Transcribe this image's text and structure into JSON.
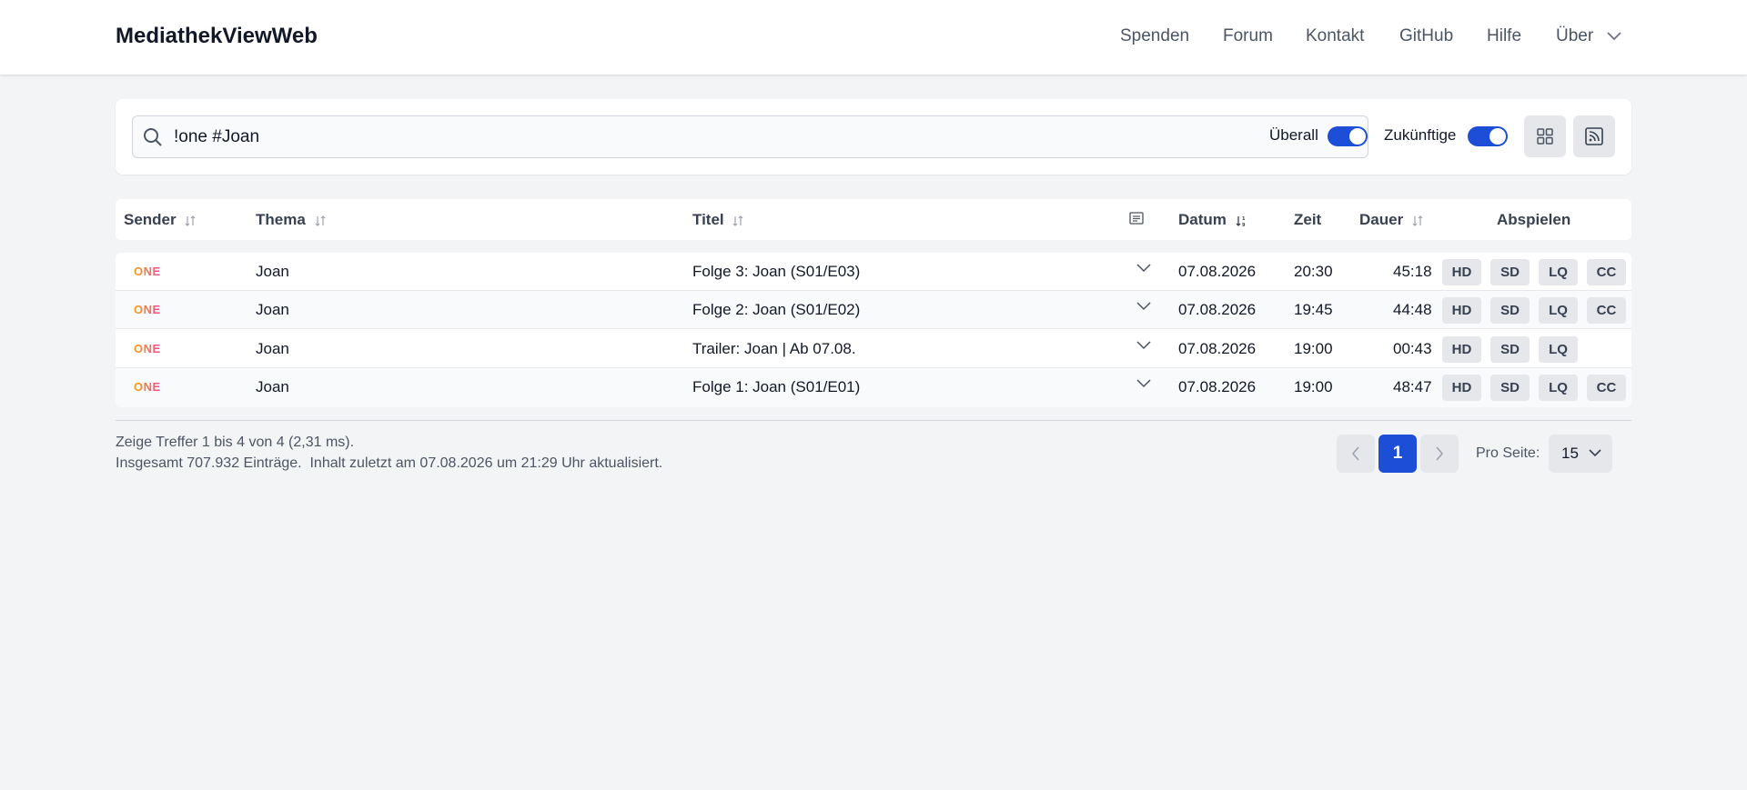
{
  "header": {
    "brand": "MediathekViewWeb",
    "nav": [
      "Spenden",
      "Forum",
      "Kontakt",
      "GitHub",
      "Hilfe",
      "Über"
    ]
  },
  "search": {
    "query": "!one #Joan",
    "toggle_everywhere_label": "Überall",
    "toggle_everywhere_on": true,
    "toggle_future_label": "Zukünftige",
    "toggle_future_on": true
  },
  "table": {
    "columns": {
      "sender": "Sender",
      "thema": "Thema",
      "titel": "Titel",
      "datum": "Datum",
      "zeit": "Zeit",
      "dauer": "Dauer",
      "abspielen": "Abspielen"
    },
    "rows": [
      {
        "sender": "ONE",
        "thema": "Joan",
        "titel": "Folge 3: Joan (S01/E03)",
        "datum": "07.08.2026",
        "zeit": "20:30",
        "dauer": "45:18",
        "q1": "HD",
        "q2": "SD",
        "q3": "LQ",
        "q4": "CC"
      },
      {
        "sender": "ONE",
        "thema": "Joan",
        "titel": "Folge 2: Joan (S01/E02)",
        "datum": "07.08.2026",
        "zeit": "19:45",
        "dauer": "44:48",
        "q1": "HD",
        "q2": "SD",
        "q3": "LQ",
        "q4": "CC"
      },
      {
        "sender": "ONE",
        "thema": "Joan",
        "titel": "Trailer: Joan | Ab 07.08.",
        "datum": "07.08.2026",
        "zeit": "19:00",
        "dauer": "00:43",
        "q1": "HD",
        "q2": "SD",
        "q3": "LQ"
      },
      {
        "sender": "ONE",
        "thema": "Joan",
        "titel": "Folge 1: Joan (S01/E01)",
        "datum": "07.08.2026",
        "zeit": "19:00",
        "dauer": "48:47",
        "q1": "HD",
        "q2": "SD",
        "q3": "LQ",
        "q4": "CC"
      }
    ]
  },
  "footer": {
    "hits": "Zeige Treffer 1 bis 4 von 4 (2,31 ms).",
    "total": "Insgesamt 707.932 Einträge.  Inhalt zuletzt am 07.08.2026 um 21:29 Uhr aktualisiert.",
    "current_page": "1",
    "per_page_label": "Pro Seite:",
    "per_page_value": "15"
  },
  "colors": {
    "accent": "#1d4ed8",
    "background": "#f3f4f6",
    "sender_logo_gradient": [
      "#f59e0b",
      "#ec4899"
    ]
  }
}
